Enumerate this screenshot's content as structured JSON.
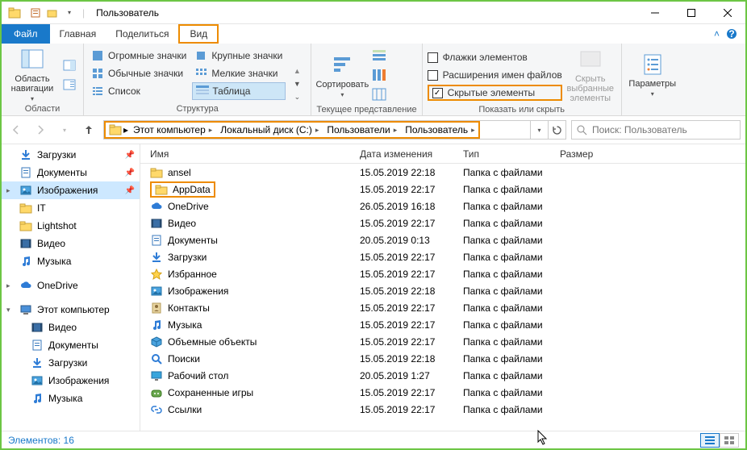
{
  "title": "Пользователь",
  "tabs": {
    "file": "Файл",
    "home": "Главная",
    "share": "Поделиться",
    "view": "Вид"
  },
  "ribbon": {
    "panes": {
      "nav_area": "Область навигации",
      "group": "Области"
    },
    "layout": {
      "extra_large": "Огромные значки",
      "large": "Крупные значки",
      "medium": "Обычные значки",
      "small": "Мелкие значки",
      "list": "Список",
      "details": "Таблица",
      "group": "Структура"
    },
    "current_view": {
      "sort": "Сортировать",
      "group": "Текущее представление"
    },
    "showhide": {
      "item_checkboxes": "Флажки элементов",
      "file_ext": "Расширения имен файлов",
      "hidden_items": "Скрытые элементы",
      "hide_selected": "Скрыть выбранные элементы",
      "group": "Показать или скрыть"
    },
    "options": {
      "label": "Параметры"
    }
  },
  "breadcrumbs": [
    "Этот компьютер",
    "Локальный диск (C:)",
    "Пользователи",
    "Пользователь"
  ],
  "search_placeholder": "Поиск: Пользователь",
  "tree": [
    {
      "label": "Загрузки",
      "icon": "download",
      "pinned": true
    },
    {
      "label": "Документы",
      "icon": "doc",
      "pinned": true
    },
    {
      "label": "Изображения",
      "icon": "pic",
      "pinned": true,
      "selected": true,
      "expander": ">"
    },
    {
      "label": "IT",
      "icon": "folder"
    },
    {
      "label": "Lightshot",
      "icon": "folder"
    },
    {
      "label": "Видео",
      "icon": "video"
    },
    {
      "label": "Музыка",
      "icon": "music"
    },
    {
      "spacer": true
    },
    {
      "label": "OneDrive",
      "icon": "cloud",
      "expander": ">"
    },
    {
      "spacer": true
    },
    {
      "label": "Этот компьютер",
      "icon": "pc",
      "expander": "v"
    },
    {
      "label": "Видео",
      "icon": "video",
      "indent": 2
    },
    {
      "label": "Документы",
      "icon": "doc",
      "indent": 2
    },
    {
      "label": "Загрузки",
      "icon": "download",
      "indent": 2
    },
    {
      "label": "Изображения",
      "icon": "pic",
      "indent": 2
    },
    {
      "label": "Музыка",
      "icon": "music",
      "indent": 2
    }
  ],
  "columns": {
    "name": "Имя",
    "date": "Дата изменения",
    "type": "Тип",
    "size": "Размер"
  },
  "rows": [
    {
      "name": "ansel",
      "date": "15.05.2019 22:18",
      "type": "Папка с файлами",
      "icon": "folder"
    },
    {
      "name": "AppData",
      "date": "15.05.2019 22:17",
      "type": "Папка с файлами",
      "icon": "folder",
      "highlight": true
    },
    {
      "name": "OneDrive",
      "date": "26.05.2019 16:18",
      "type": "Папка с файлами",
      "icon": "cloud"
    },
    {
      "name": "Видео",
      "date": "15.05.2019 22:17",
      "type": "Папка с файлами",
      "icon": "video"
    },
    {
      "name": "Документы",
      "date": "20.05.2019 0:13",
      "type": "Папка с файлами",
      "icon": "doc"
    },
    {
      "name": "Загрузки",
      "date": "15.05.2019 22:17",
      "type": "Папка с файлами",
      "icon": "download"
    },
    {
      "name": "Избранное",
      "date": "15.05.2019 22:17",
      "type": "Папка с файлами",
      "icon": "star"
    },
    {
      "name": "Изображения",
      "date": "15.05.2019 22:18",
      "type": "Папка с файлами",
      "icon": "pic"
    },
    {
      "name": "Контакты",
      "date": "15.05.2019 22:17",
      "type": "Папка с файлами",
      "icon": "contacts"
    },
    {
      "name": "Музыка",
      "date": "15.05.2019 22:17",
      "type": "Папка с файлами",
      "icon": "music"
    },
    {
      "name": "Объемные объекты",
      "date": "15.05.2019 22:17",
      "type": "Папка с файлами",
      "icon": "3d"
    },
    {
      "name": "Поиски",
      "date": "15.05.2019 22:18",
      "type": "Папка с файлами",
      "icon": "search"
    },
    {
      "name": "Рабочий стол",
      "date": "20.05.2019 1:27",
      "type": "Папка с файлами",
      "icon": "desktop"
    },
    {
      "name": "Сохраненные игры",
      "date": "15.05.2019 22:17",
      "type": "Папка с файлами",
      "icon": "games"
    },
    {
      "name": "Ссылки",
      "date": "15.05.2019 22:17",
      "type": "Папка с файлами",
      "icon": "links"
    }
  ],
  "status": "Элементов: 16"
}
